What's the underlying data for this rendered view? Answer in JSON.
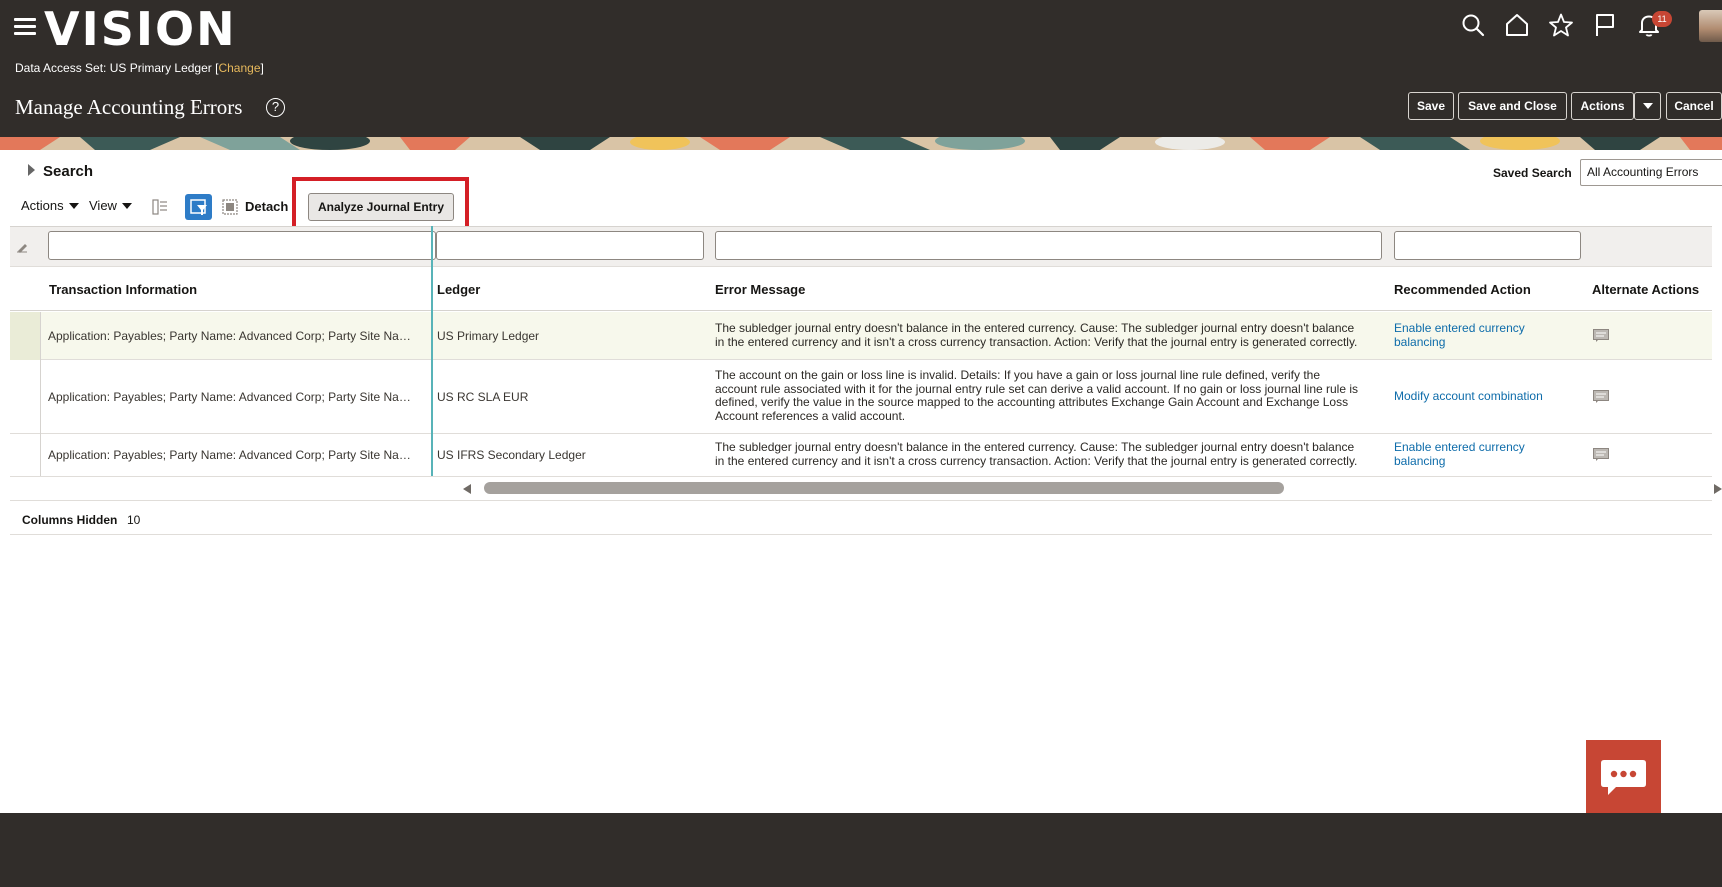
{
  "app": {
    "logo": "VISION",
    "notification_count": "11",
    "data_access_set": {
      "label": "Data Access Set:",
      "value": "US Primary Ledger",
      "change_link": "Change"
    },
    "page_title": "Manage Accounting Errors",
    "help_icon": "?"
  },
  "header_icons": [
    "search-icon",
    "home-icon",
    "star-icon",
    "flag-icon",
    "bell-icon"
  ],
  "page_buttons": {
    "save": "Save",
    "save_close": "Save and Close",
    "actions": "Actions",
    "cancel": "Cancel"
  },
  "search": {
    "label": "Search",
    "saved_search_label": "Saved Search",
    "saved_search_value": "All Accounting Errors"
  },
  "toolbar": {
    "actions": "Actions",
    "view": "View",
    "detach": "Detach",
    "analyze": "Analyze Journal Entry"
  },
  "table": {
    "columns": [
      "Transaction Information",
      "Ledger",
      "Error Message",
      "Recommended Action",
      "Alternate Actions"
    ],
    "rows": [
      {
        "transaction_info": "Application: Payables; Party Name: Advanced Corp; Party Site Na…",
        "ledger": "US Primary Ledger",
        "error_line1": "The subledger journal entry doesn't balance in the entered currency. Cause: The subledger journal entry doesn't balance",
        "error_line2": "in the entered currency and it isn't a cross currency transaction. Action: Verify that the journal entry is generated correctly.",
        "error_line3": "",
        "error_line4": "",
        "action_line1": "Enable entered currency",
        "action_line2": "balancing"
      },
      {
        "transaction_info": "Application: Payables; Party Name: Advanced Corp; Party Site Na…",
        "ledger": "US RC SLA EUR",
        "error_line1": "The account on the gain or loss line is invalid. Details: If you have a gain or loss journal line rule defined, verify the",
        "error_line2": "account rule associated with it for the journal entry rule set can derive a valid account. If no gain or loss journal line rule is",
        "error_line3": "defined, verify the value in the source mapped to the accounting attributes Exchange Gain Account and Exchange Loss",
        "error_line4": "Account references a valid account.",
        "action_line1": "Modify account combination",
        "action_line2": ""
      },
      {
        "transaction_info": "Application: Payables; Party Name: Advanced Corp; Party Site Na…",
        "ledger": "US IFRS Secondary Ledger",
        "error_line1": "The subledger journal entry doesn't balance in the entered currency. Cause: The subledger journal entry doesn't balance",
        "error_line2": "in the entered currency and it isn't a cross currency transaction. Action: Verify that the journal entry is generated correctly.",
        "error_line3": "",
        "error_line4": "",
        "action_line1": "Enable entered currency",
        "action_line2": "balancing"
      }
    ],
    "columns_hidden_label": "Columns Hidden",
    "columns_hidden_count": "10"
  },
  "colors": {
    "header_bg": "#312d2a",
    "link": "#0e6caa",
    "highlight": "#d41f26",
    "accent_blue": "#2e7cc7",
    "chat": "#c74634"
  }
}
